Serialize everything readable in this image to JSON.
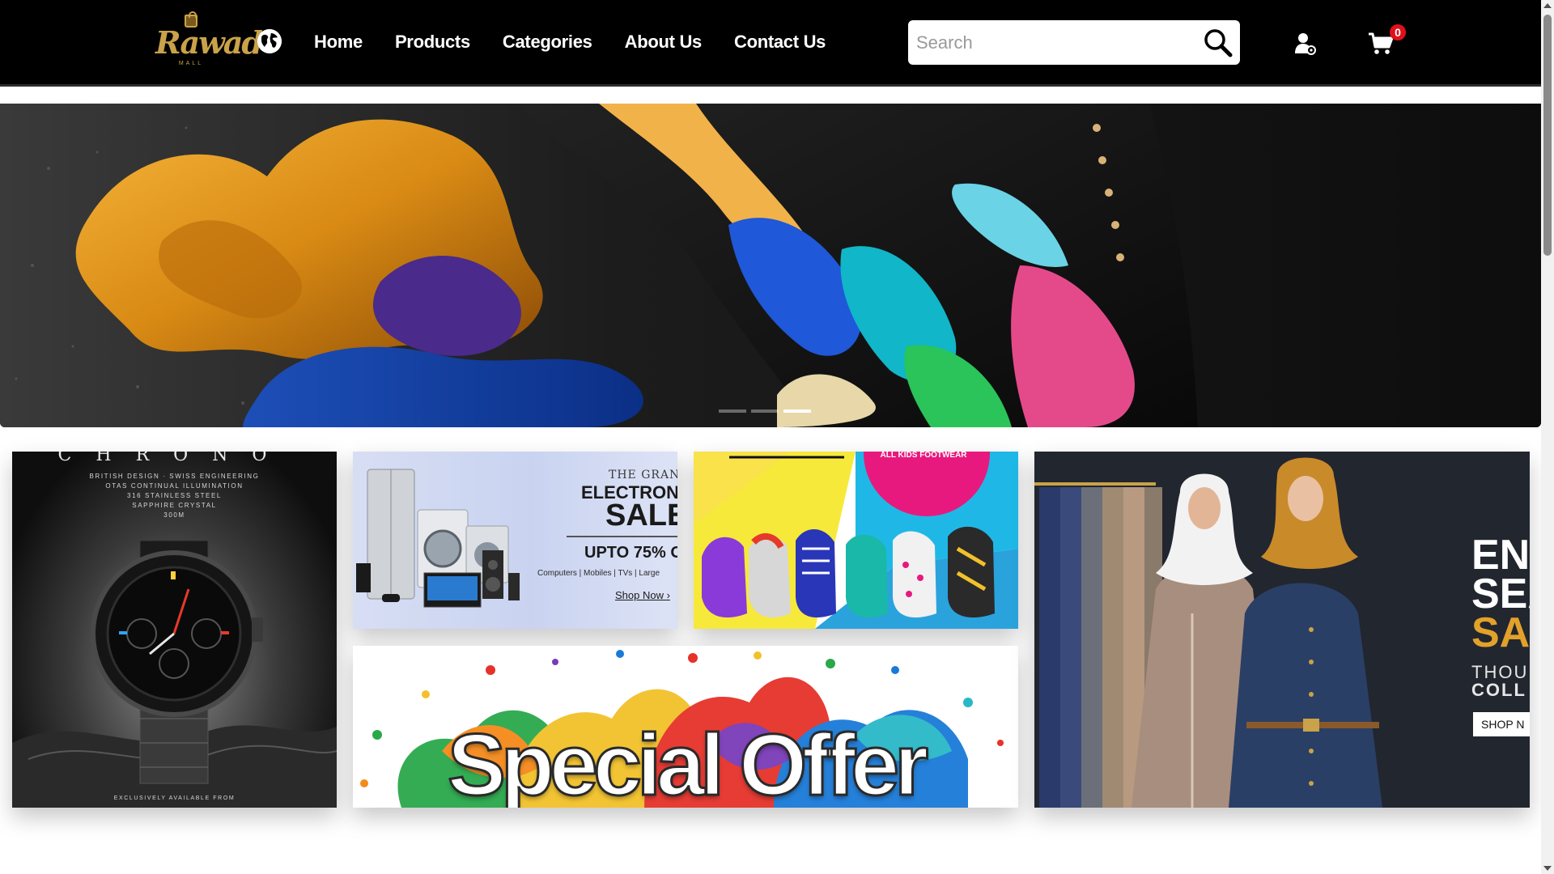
{
  "header": {
    "logo_text": "Rawad",
    "logo_subtext": "MALL",
    "nav": [
      {
        "label": "Home"
      },
      {
        "label": "Products"
      },
      {
        "label": "Categories"
      },
      {
        "label": "About Us"
      },
      {
        "label": "Contact Us"
      }
    ],
    "search": {
      "placeholder": "Search"
    },
    "cart": {
      "count": "0"
    },
    "icons": {
      "language": "globe-icon",
      "search": "search-icon",
      "account": "user-icon",
      "cart": "cart-icon"
    }
  },
  "hero": {
    "slides": 3,
    "active_slide": 2
  },
  "tiles": {
    "watch": {
      "brand": "CHRONO",
      "specs": [
        "BRITISH DESIGN · SWISS ENGINEERING",
        "OTAS CONTINUAL ILLUMINATION",
        "316 STAINLESS STEEL",
        "SAPPHIRE CRYSTAL",
        "300M"
      ],
      "footer": "EXCLUSIVELY AVAILABLE FROM"
    },
    "electronics": {
      "line1": "THE GRAN",
      "line2": "ELECTRON",
      "line3": "SALE",
      "offer": "UPTO 75% O",
      "categories": "Computers | Mobiles | TVs | Large",
      "cta": "Shop Now ›"
    },
    "kids": {
      "badge": "ALL KIDS FOOTWEAR"
    },
    "special": {
      "title": "Special Offer"
    },
    "fashion": {
      "line1": "EN",
      "line2": "SEA",
      "line3": "SA",
      "line4": "THOU",
      "line5": "COLL",
      "cta": "SHOP N"
    }
  },
  "colors": {
    "header_bg": "#000000",
    "gold": "#c9a24a",
    "badge_red": "#e0101b",
    "fashion_accent": "#e2a12a"
  }
}
